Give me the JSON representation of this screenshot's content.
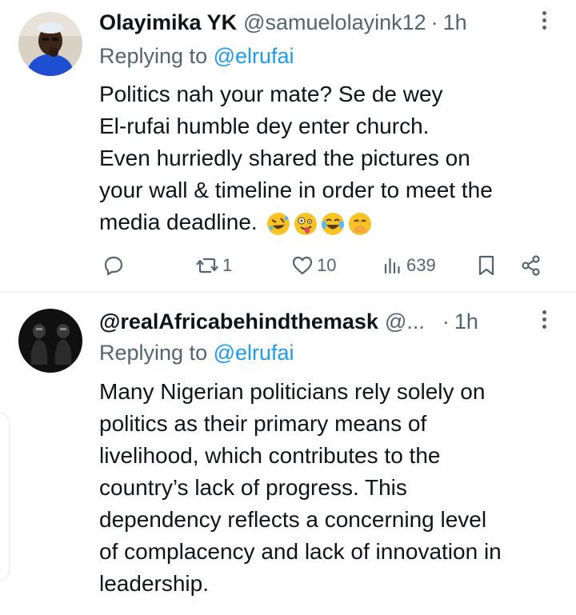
{
  "tweets": [
    {
      "author_name": "Olayimika YK",
      "author_handle": "@samuelolayink12",
      "separator": "·",
      "time": "1h",
      "replying_prefix": "Replying to ",
      "replying_to": "@elrufai",
      "lines": [
        "Politics nah your mate? Se de wey",
        "El-rufai humble dey enter church.",
        "Even hurriedly shared the pictures on",
        "your wall & timeline in order to meet the",
        "media deadline."
      ],
      "emojis": [
        "rolling-on-floor-laughing",
        "zany-face",
        "face-with-tears-of-joy",
        "face-with-hand-over-mouth"
      ],
      "actions": {
        "reply_count": "",
        "retweet_count": "1",
        "like_count": "10",
        "views_count": "639"
      }
    },
    {
      "author_name": "@realAfricabehindthemask",
      "author_handle": "@...",
      "separator": "·",
      "time": "1h",
      "replying_prefix": "Replying to ",
      "replying_to": "@elrufai",
      "lines": [
        "Many Nigerian politicians rely solely on",
        "politics as their primary means of",
        "livelihood, which contributes to the",
        "country’s lack of progress. This",
        "dependency reflects a concerning level",
        "of complacency and lack of innovation in",
        "leadership."
      ]
    }
  ],
  "colors": {
    "text": "#0f1419",
    "secondary": "#536471",
    "link": "#1d9bf0",
    "divider": "#e7e9ea"
  }
}
